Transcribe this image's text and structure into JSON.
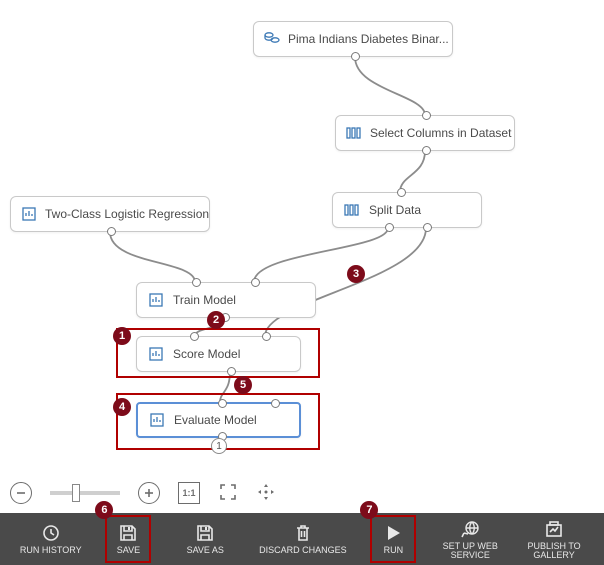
{
  "nodes": {
    "dataset": {
      "label": "Pima Indians Diabetes Binar..."
    },
    "select_cols": {
      "label": "Select Columns in Dataset"
    },
    "logistic": {
      "label": "Two-Class Logistic Regression"
    },
    "split": {
      "label": "Split Data"
    },
    "train": {
      "label": "Train Model"
    },
    "score": {
      "label": "Score Model"
    },
    "evaluate": {
      "label": "Evaluate Model"
    }
  },
  "badges": {
    "b1": "1",
    "b2": "2",
    "b3": "3",
    "b4": "4",
    "b5": "5",
    "b6": "6",
    "b7": "7"
  },
  "port_label": "1",
  "zoom": {
    "one_to_one": "1:1"
  },
  "toolbar": {
    "run_history": "RUN HISTORY",
    "save": "SAVE",
    "save_as": "SAVE AS",
    "discard": "DISCARD CHANGES",
    "run": "RUN",
    "setup_ws": "SET UP WEB\nSERVICE",
    "publish": "PUBLISH TO\nGALLERY"
  }
}
